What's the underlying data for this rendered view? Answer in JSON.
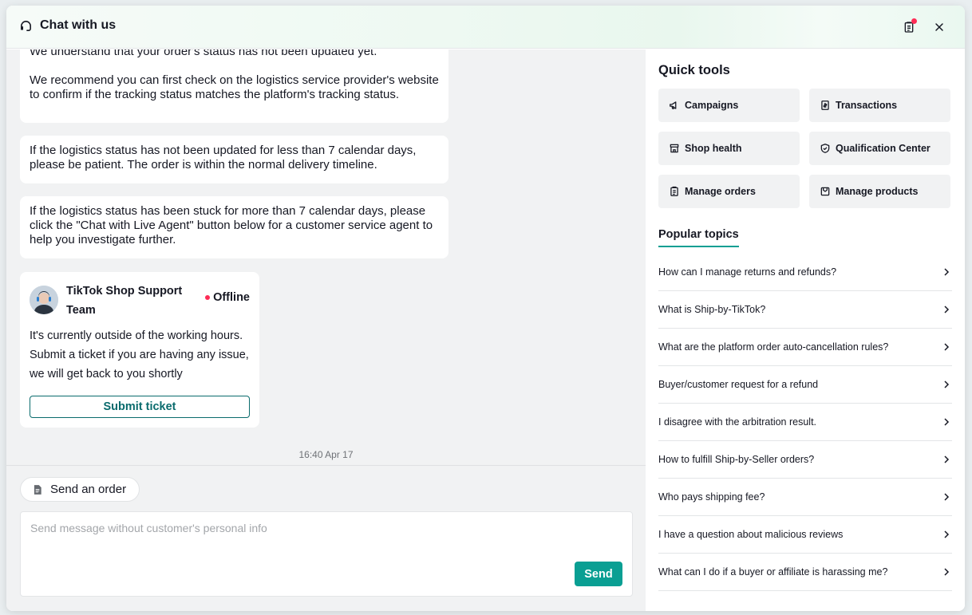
{
  "header": {
    "title": "Chat with us",
    "icons": [
      "headset-icon",
      "clipboard-icon",
      "close-icon"
    ]
  },
  "chat": {
    "bubble1": {
      "line1": "We understand that your order's status has not been updated yet.",
      "line2": "We recommend you can first check on the logistics service provider's website to confirm if the tracking status matches the platform's tracking status."
    },
    "bubble2": "If the logistics status has not been updated for less than 7 calendar days, please be patient. The order is within the normal delivery timeline.",
    "bubble3": "If the logistics status has been stuck for more than 7 calendar days, please click the \"Chat with Live Agent\" button below for a customer service agent to help you investigate further.",
    "card": {
      "name": "TikTok Shop Support Team",
      "status": "Offline",
      "status_color": "#fe2c55",
      "text": "It's currently outside of the working hours. Submit a ticket if you are having any issue, we will get back to you shortly",
      "button": "Submit ticket"
    },
    "timestamp": "16:40 Apr 17"
  },
  "composer": {
    "send_order": "Send an order",
    "placeholder": "Send message without customer's personal info",
    "send": "Send",
    "accent": "#0a9f93"
  },
  "quick_tools": {
    "title": "Quick tools",
    "items": [
      {
        "label": "Campaigns",
        "icon": "megaphone-icon"
      },
      {
        "label": "Transactions",
        "icon": "receipt-icon"
      },
      {
        "label": "Shop health",
        "icon": "store-icon"
      },
      {
        "label": "Qualification Center",
        "icon": "shield-icon"
      },
      {
        "label": "Manage orders",
        "icon": "clipboard-icon"
      },
      {
        "label": "Manage products",
        "icon": "box-icon"
      }
    ]
  },
  "popular_topics": {
    "title": "Popular topics",
    "items": [
      "How can I manage returns and refunds?",
      "What is Ship-by-TikTok?",
      "What are the platform order auto-cancellation rules?",
      "Buyer/customer request for a refund",
      "I disagree with the arbitration result.",
      "How to fulfill Ship-by-Seller orders?",
      "Who pays shipping fee?",
      "I have a question about malicious reviews",
      "What can I do if a buyer or affiliate is harassing me?"
    ]
  }
}
